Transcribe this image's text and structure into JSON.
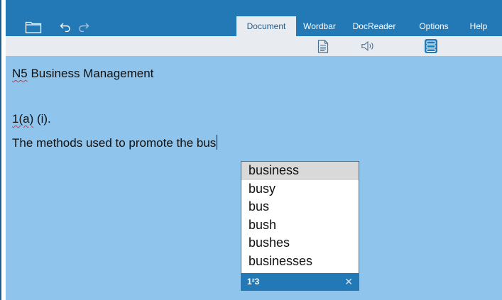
{
  "toolbar": {
    "icons": [
      "folder-icon",
      "undo-icon",
      "redo-icon"
    ]
  },
  "tabs": [
    {
      "label": "Document",
      "active": true
    },
    {
      "label": "Wordbar",
      "active": false
    },
    {
      "label": "DocReader",
      "active": false
    },
    {
      "label": "Options",
      "active": false
    },
    {
      "label": "Help",
      "active": false
    }
  ],
  "ribbon": {
    "icons": [
      "document-icon",
      "speaker-icon",
      "word-list-icon"
    ]
  },
  "document": {
    "line1": "N5 Business Management",
    "line2_part1": "1(a)",
    "line2_part2": " (i).",
    "line3": "The methods used to promote the bus"
  },
  "suggestions": {
    "items": [
      "business",
      "busy",
      "bus",
      "bush",
      "bushes",
      "businesses"
    ],
    "selected_index": 0,
    "numbers_label": "1²3",
    "close_label": "✕"
  },
  "colors": {
    "topbar": "#2379b5",
    "document_bg": "#8fc4ec",
    "ribbon_bg": "#e8ecf1",
    "accent": "#2379b5"
  }
}
